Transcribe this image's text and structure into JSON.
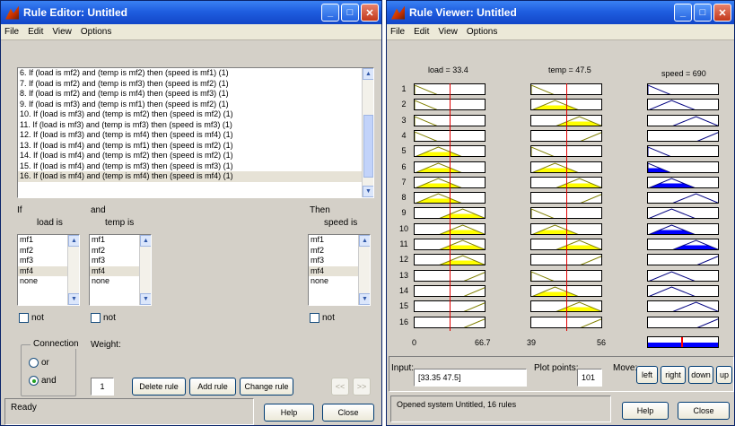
{
  "editor": {
    "title": "Rule Editor: Untitled",
    "menu": [
      "File",
      "Edit",
      "View",
      "Options"
    ],
    "rules": [
      "6. If (load is mf2) and (temp is mf2) then (speed is mf1) (1)",
      "7. If (load is mf2) and (temp is mf3) then (speed is mf2) (1)",
      "8. If (load is mf2) and (temp is mf4) then (speed is mf3) (1)",
      "9. If (load is mf3) and (temp is mf1) then (speed is mf2) (1)",
      "10. If (load is mf3) and (temp is mf2) then (speed is mf2) (1)",
      "11. If (load is mf3) and (temp is mf3) then (speed is mf3) (1)",
      "12. If (load is mf3) and (temp is mf4) then (speed is mf4) (1)",
      "13. If (load is mf4) and (temp is mf1) then (speed is mf2) (1)",
      "14. If (load is mf4) and (temp is mf2) then (speed is mf2) (1)",
      "15. If (load is mf4) and (temp is mf3) then (speed is mf3) (1)",
      "16. If (load is mf4) and (temp is mf4) then (speed is mf4) (1)"
    ],
    "selected_rule_index": 10,
    "if_label": "If",
    "and_label": "and",
    "then_label": "Then",
    "load_label": "load is",
    "temp_label": "temp is",
    "speed_label": "speed is",
    "mf_items": [
      "mf1",
      "mf2",
      "mf3",
      "mf4",
      "none"
    ],
    "load_selected": "mf4",
    "temp_selected": "mf4",
    "speed_selected": "mf4",
    "not_label": "not",
    "connection_label": "Connection",
    "or_label": "or",
    "and_radio_label": "and",
    "connection_value": "and",
    "weight_label": "Weight:",
    "weight_value": "1",
    "delete_rule": "Delete rule",
    "add_rule": "Add rule",
    "change_rule": "Change rule",
    "prev_btn": "<<",
    "next_btn": ">>",
    "status": "Ready",
    "help": "Help",
    "close": "Close"
  },
  "viewer": {
    "title": "Rule Viewer: Untitled",
    "menu": [
      "File",
      "Edit",
      "View",
      "Options"
    ],
    "load_head": "load = 33.4",
    "temp_head": "temp = 47.5",
    "speed_head": "speed = 690",
    "load_value": 33.4,
    "temp_value": 47.5,
    "speed_value": 690,
    "load_range": [
      0,
      66.7
    ],
    "temp_range": [
      39,
      56
    ],
    "load_axis_min": "0",
    "load_axis_max": "66.7",
    "temp_axis_min": "39",
    "temp_axis_max": "56",
    "rules": [
      {
        "load": "mf1",
        "temp": "mf1",
        "speed": "mf1"
      },
      {
        "load": "mf1",
        "temp": "mf2",
        "speed": "mf2"
      },
      {
        "load": "mf1",
        "temp": "mf3",
        "speed": "mf3"
      },
      {
        "load": "mf1",
        "temp": "mf4",
        "speed": "mf4"
      },
      {
        "load": "mf2",
        "temp": "mf1",
        "speed": "mf1"
      },
      {
        "load": "mf2",
        "temp": "mf2",
        "speed": "mf1"
      },
      {
        "load": "mf2",
        "temp": "mf3",
        "speed": "mf2"
      },
      {
        "load": "mf2",
        "temp": "mf4",
        "speed": "mf3"
      },
      {
        "load": "mf3",
        "temp": "mf1",
        "speed": "mf2"
      },
      {
        "load": "mf3",
        "temp": "mf2",
        "speed": "mf2"
      },
      {
        "load": "mf3",
        "temp": "mf3",
        "speed": "mf3"
      },
      {
        "load": "mf3",
        "temp": "mf4",
        "speed": "mf4"
      },
      {
        "load": "mf4",
        "temp": "mf1",
        "speed": "mf2"
      },
      {
        "load": "mf4",
        "temp": "mf2",
        "speed": "mf2"
      },
      {
        "load": "mf4",
        "temp": "mf3",
        "speed": "mf3"
      },
      {
        "load": "mf4",
        "temp": "mf4",
        "speed": "mf4"
      }
    ],
    "input_label": "Input:",
    "input_value": "[33.35 47.5]",
    "plot_points_label": "Plot points:",
    "plot_points_value": "101",
    "move_label": "Move:",
    "move_buttons": [
      "left",
      "right",
      "down",
      "up"
    ],
    "status": "Opened system Untitled, 16 rules",
    "help": "Help",
    "close": "Close",
    "colors": {
      "input_fill": "#ffff00",
      "output_fill": "#0000ff",
      "line": "#808000",
      "indicator": "#ff0000"
    }
  }
}
